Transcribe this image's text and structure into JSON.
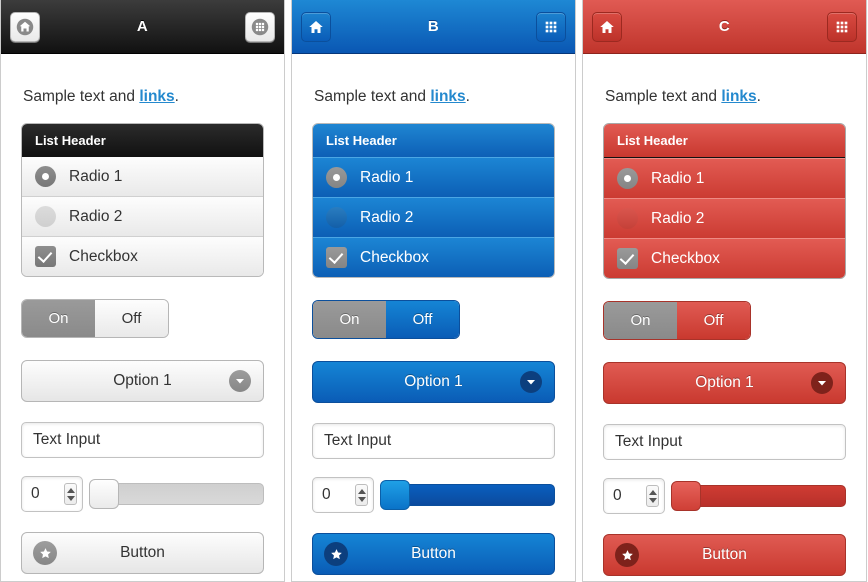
{
  "panels": [
    {
      "id": "A",
      "theme": "pA",
      "title": "A",
      "home_icon": "home-icon",
      "grid_icon": "grid-icon",
      "sample_prefix": "Sample text and ",
      "sample_link": "links",
      "sample_suffix": ".",
      "list_header": "List Header",
      "rows": [
        {
          "control": "radio-selected",
          "label": "Radio 1"
        },
        {
          "control": "radio-unselected",
          "label": "Radio 2"
        },
        {
          "control": "checkbox-checked",
          "label": "Checkbox"
        }
      ],
      "toggle": {
        "on_label": "On",
        "off_label": "Off",
        "selected": "On"
      },
      "select_value": "Option 1",
      "select_chevron_icon": "chevron-down-icon",
      "text_input_value": "Text Input",
      "spinner_value": "0",
      "slider_value": 0,
      "button_label": "Button",
      "button_icon": "star-icon",
      "accent": "#8a8a8a"
    },
    {
      "id": "B",
      "theme": "pB",
      "title": "B",
      "home_icon": "home-icon",
      "grid_icon": "grid-icon",
      "sample_prefix": "Sample text and ",
      "sample_link": "links",
      "sample_suffix": ".",
      "list_header": "List Header",
      "rows": [
        {
          "control": "radio-selected",
          "label": "Radio 1"
        },
        {
          "control": "radio-unselected",
          "label": "Radio 2"
        },
        {
          "control": "checkbox-checked",
          "label": "Checkbox"
        }
      ],
      "toggle": {
        "on_label": "On",
        "off_label": "Off",
        "selected": "On"
      },
      "select_value": "Option 1",
      "select_chevron_icon": "chevron-down-icon",
      "text_input_value": "Text Input",
      "spinner_value": "0",
      "slider_value": 0,
      "button_label": "Button",
      "button_icon": "star-icon",
      "accent": "#0a5cb6"
    },
    {
      "id": "C",
      "theme": "pC",
      "title": "C",
      "home_icon": "home-icon",
      "grid_icon": "grid-icon",
      "sample_prefix": "Sample text and ",
      "sample_link": "links",
      "sample_suffix": ".",
      "list_header": "List Header",
      "rows": [
        {
          "control": "radio-selected",
          "label": "Radio 1"
        },
        {
          "control": "radio-unselected",
          "label": "Radio 2"
        },
        {
          "control": "checkbox-checked",
          "label": "Checkbox"
        }
      ],
      "toggle": {
        "on_label": "On",
        "off_label": "Off",
        "selected": "On"
      },
      "select_value": "Option 1",
      "select_chevron_icon": "chevron-down-icon",
      "text_input_value": "Text Input",
      "spinner_value": "0",
      "slider_value": 0,
      "button_label": "Button",
      "button_icon": "star-icon",
      "accent": "#c9392f"
    }
  ],
  "link_color": "#2489ce"
}
